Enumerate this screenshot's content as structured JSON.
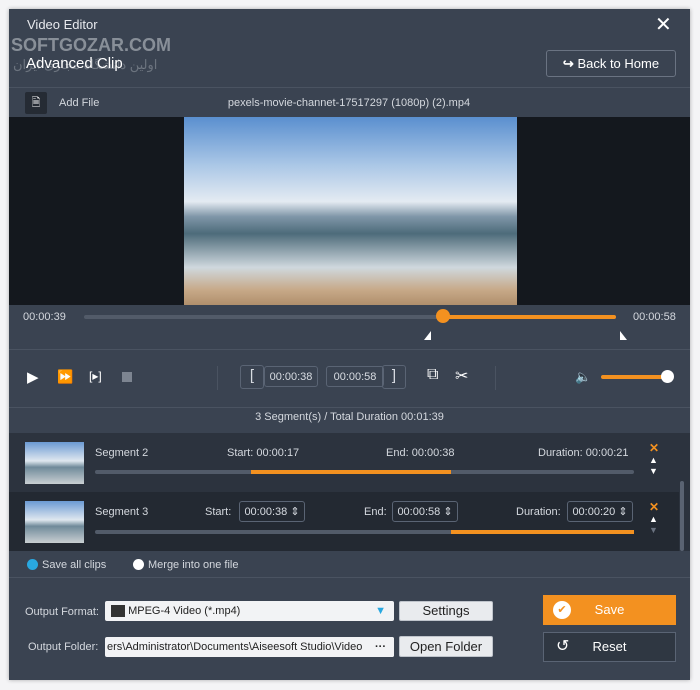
{
  "window": {
    "title": "Video Editor",
    "subtitle": "Advanced Clip",
    "watermark": "SOFTGOZAR.COM",
    "watermark_sub": "اولین دانشگاه مجازی ایران",
    "back_label": "Back to Home"
  },
  "toolbar": {
    "add_file": "Add File",
    "filename": "pexels-movie-channet-17517297 (1080p) (2).mp4"
  },
  "timeline": {
    "left_time": "00:00:39",
    "right_time": "00:00:58",
    "playhead_fraction": 0.67,
    "range_start_fraction": 0.67,
    "range_end_fraction": 1.0
  },
  "controls": {
    "start_time": "00:00:38",
    "end_time": "00:00:58",
    "volume_fraction": 1.0
  },
  "summary": "3 Segment(s) / Total Duration 00:01:39",
  "segments": [
    {
      "name": "Segment 2",
      "start_label": "Start:",
      "start": "00:00:17",
      "end_label": "End:",
      "end": "00:00:38",
      "duration_label": "Duration:",
      "duration": "00:00:21",
      "range": [
        0.29,
        0.66
      ]
    },
    {
      "name": "Segment 3",
      "start_label": "Start:",
      "start": "00:00:38",
      "end_label": "End:",
      "end": "00:00:58",
      "duration_label": "Duration:",
      "duration": "00:00:20",
      "range": [
        0.66,
        1.0
      ]
    }
  ],
  "options": {
    "save_all": "Save all clips",
    "merge": "Merge into one file"
  },
  "output": {
    "format_label": "Output Format:",
    "format_value": "MPEG-4 Video (*.mp4)",
    "settings": "Settings",
    "folder_label": "Output Folder:",
    "folder_value": "ers\\Administrator\\Documents\\Aiseesoft Studio\\Video",
    "open_folder": "Open Folder",
    "save": "Save",
    "reset": "Reset"
  },
  "colors": {
    "accent": "#f39120",
    "radio_selected": "#29a8e0"
  }
}
